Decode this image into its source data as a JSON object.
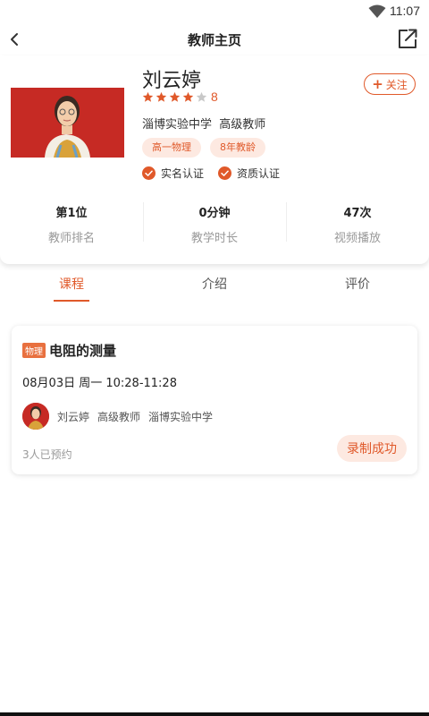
{
  "status_bar": {
    "time": "11:07"
  },
  "nav": {
    "title": "教师主页"
  },
  "teacher": {
    "name": "刘云婷",
    "rating_stars": 4,
    "rating_max": 5,
    "rating_count": "8",
    "school": "淄博实验中学",
    "title": "高级教师",
    "tags": [
      "高一物理",
      "8年教龄"
    ],
    "certifications": [
      "实名认证",
      "资质认证"
    ]
  },
  "follow": {
    "label": "关注"
  },
  "stats": [
    {
      "value": "第1位",
      "label": "教师排名"
    },
    {
      "value": "0分钟",
      "label": "教学时长"
    },
    {
      "value": "47次",
      "label": "视频播放"
    }
  ],
  "tabs": [
    {
      "label": "课程",
      "active": true
    },
    {
      "label": "介绍",
      "active": false
    },
    {
      "label": "评价",
      "active": false
    }
  ],
  "course": {
    "subject": "物理",
    "title": "电阻的测量",
    "time": "08月03日 周一 10:28-11:28",
    "teacher_name": "刘云婷",
    "teacher_title": "高级教师",
    "school": "淄博实验中学",
    "booked": "3人已预约",
    "status": "录制成功"
  },
  "colors": {
    "accent": "#e0592a",
    "accent_light": "#fde9e1",
    "photo_bg": "#c62a24"
  },
  "icons": [
    "wifi-icon",
    "back-chevron-icon",
    "share-icon",
    "star-icon",
    "check-circle-icon",
    "plus-icon"
  ]
}
